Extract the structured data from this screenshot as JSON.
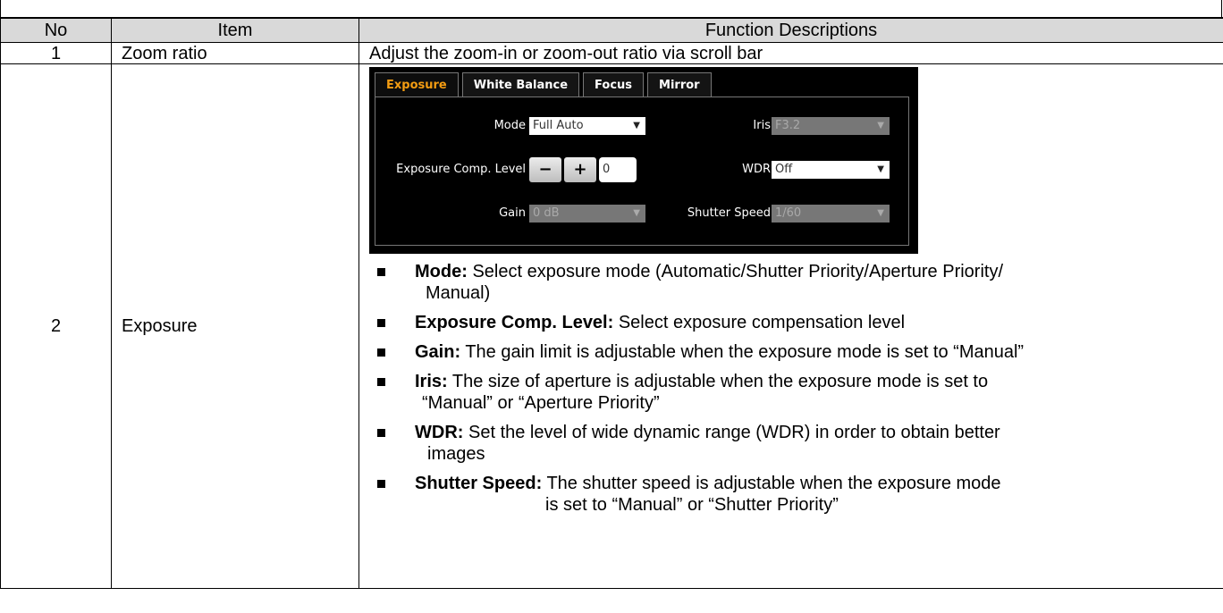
{
  "header": {
    "no": "No",
    "item": "Item",
    "desc": "Function Descriptions"
  },
  "rows": [
    {
      "no": "1",
      "item": "Zoom ratio",
      "desc": "Adjust the zoom-in or zoom-out ratio via scroll bar"
    },
    {
      "no": "2",
      "item": "Exposure"
    }
  ],
  "camera_ui": {
    "tabs": [
      "Exposure",
      "White Balance",
      "Focus",
      "Mirror"
    ],
    "active_tab": "Exposure",
    "mode_label": "Mode",
    "mode_value": "Full Auto",
    "iris_label": "Iris",
    "iris_value": "F3.2",
    "exp_comp_label": "Exposure Comp. Level",
    "minus": "−",
    "plus": "+",
    "exp_comp_value": "0",
    "wdr_label": "WDR",
    "wdr_value": "Off",
    "gain_label": "Gain",
    "gain_value": "0 dB",
    "shutter_label": "Shutter Speed",
    "shutter_value": "1/60",
    "arrow": "▼"
  },
  "bullets": [
    {
      "term": "Mode:",
      "text": " Select exposure mode (Automatic/Shutter Priority/Aperture Priority/",
      "cont": "Manual)"
    },
    {
      "term": "Exposure Comp. Level:",
      "text": " Select exposure compensation level"
    },
    {
      "term": "Gain:",
      "text": " The gain limit is adjustable when the exposure mode is set to “Manual”"
    },
    {
      "term": "Iris:",
      "text": " The size of aperture is adjustable when the exposure mode is set to",
      "cont": "“Manual” or “Aperture Priority”"
    },
    {
      "term": "WDR:",
      "text": " Set the level of wide dynamic range (WDR) in order to obtain better",
      "cont": "images"
    },
    {
      "term": "Shutter Speed:",
      "text": " The shutter speed is adjustable when the exposure mode",
      "cont": "is set to “Manual” or “Shutter Priority”"
    }
  ]
}
